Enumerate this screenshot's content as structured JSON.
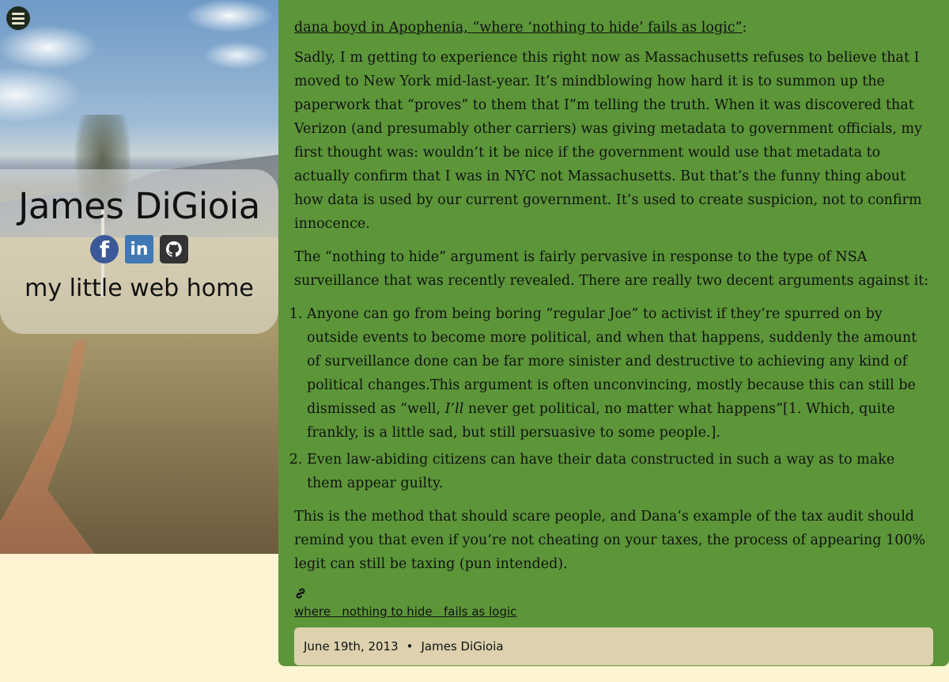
{
  "sidebar": {
    "name": "James DiGioia",
    "tagline": "my little web home",
    "social": [
      {
        "icon": "facebook-icon",
        "glyph": "f"
      },
      {
        "icon": "linkedin-icon",
        "glyph": "in"
      },
      {
        "icon": "github-icon",
        "glyph": "⌥"
      }
    ]
  },
  "post": {
    "source_link": "dana boyd in Apophenia, “where ‘nothing to hide’ fails as logic”",
    "source_suffix": ":",
    "paragraph1": "Sadly, I  m getting to experience this right now as Massachusetts refuses to believe that I moved to New York mid-last-year. It’s mindblowing how hard it is to summon up the paperwork that “proves” to them that I”m telling the truth. When it was discovered that Verizon (and presumably other carriers) was giving metadata to government officials, my first thought was: wouldn’t it be nice if the government would use that metadata to actually confirm that I was in NYC not Massachusetts. But that’s the funny thing about how data is used by our current government. It’s used to create suspicion, not to confirm innocence.",
    "paragraph2": "The “nothing to hide” argument is fairly pervasive in response to the type of NSA surveillance that was recently revealed. There are really two decent arguments against it:",
    "list": {
      "item1_before": "Anyone can go from being boring “regular Joe” to activist if they’re spurred on by outside events to become more political, and when that happens, suddenly the amount of surveillance done can be far more sinister and destructive to achieving any kind of political changes.This argument is often unconvincing, mostly because this can still be dismissed as “well, ",
      "item1_em": "I’ll",
      "item1_after": " never get political, no matter what happens”[1. Which, quite frankly, is a little sad, but still persuasive to some people.].",
      "item2": "Even law-abiding citizens can have their data constructed in such a way as to make them appear guilty."
    },
    "paragraph3": "This is the method that should scare people, and Dana’s example of the tax audit should remind you that even if you’re not cheating on your taxes, the process of appearing 100% legit can still be taxing (pun intended).",
    "link_icon": "link-icon",
    "tag": "where   nothing to hide   fails as logic",
    "date": "June 19th, 2013",
    "separator": "•",
    "author": "James DiGioia"
  },
  "colors": {
    "page_bg": "#fff5d2",
    "post_bg": "#5c9639",
    "meta_bg": "#ddd1ae"
  }
}
